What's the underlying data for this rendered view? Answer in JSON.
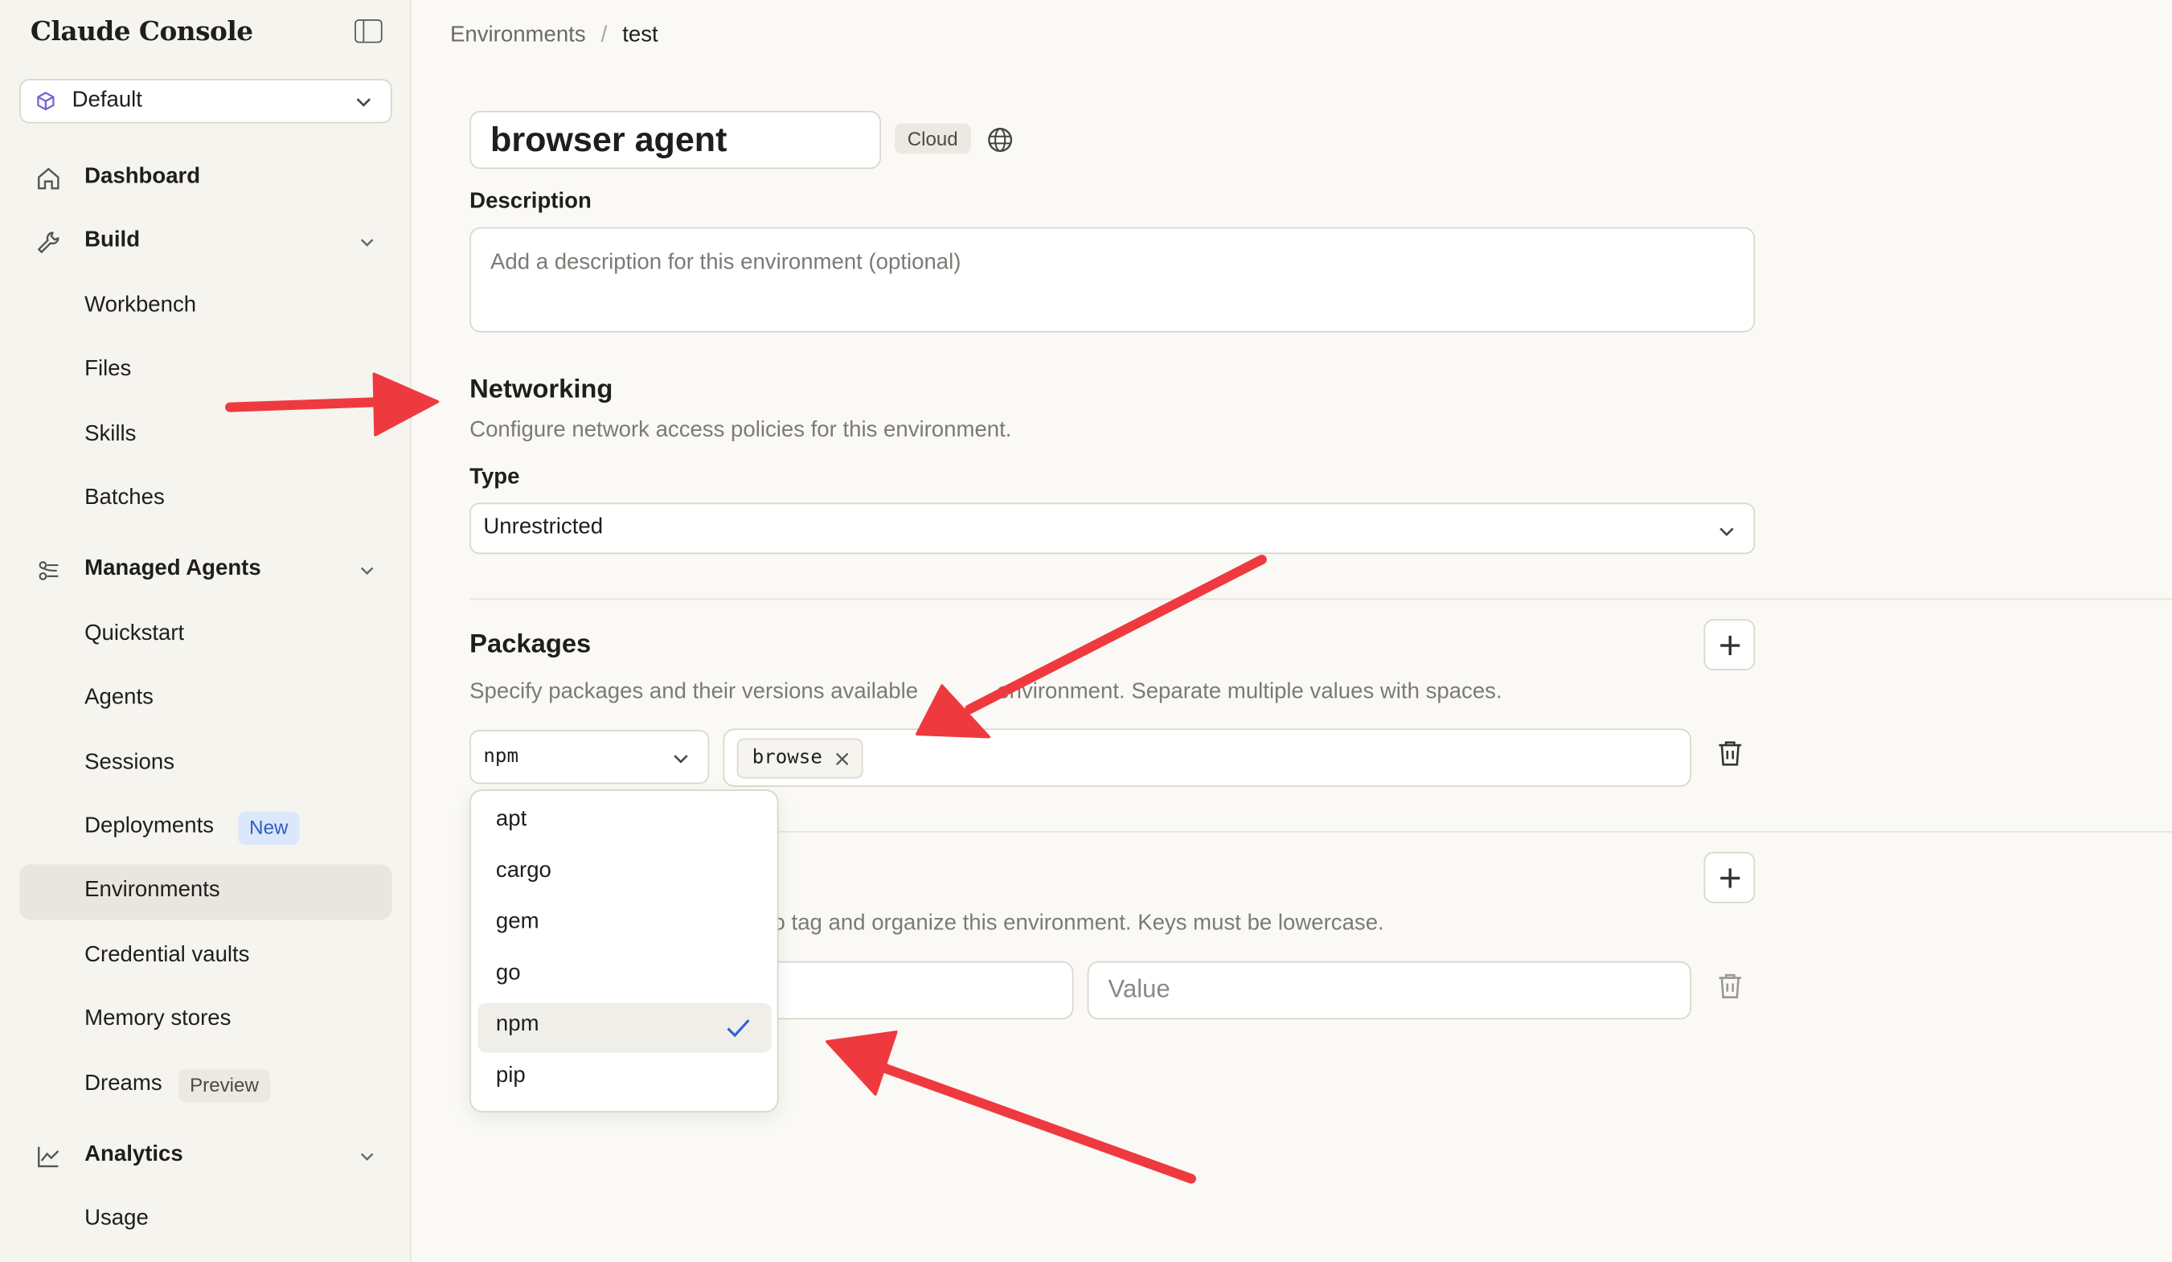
{
  "sidebar": {
    "brand": "Claude Console",
    "workspace": "Default",
    "dashboard": "Dashboard",
    "build": {
      "label": "Build",
      "items": [
        "Workbench",
        "Files",
        "Skills",
        "Batches"
      ]
    },
    "managed_agents": {
      "label": "Managed Agents",
      "items": [
        {
          "label": "Quickstart"
        },
        {
          "label": "Agents"
        },
        {
          "label": "Sessions"
        },
        {
          "label": "Deployments",
          "badge": "New"
        },
        {
          "label": "Environments",
          "active": true
        },
        {
          "label": "Credential vaults"
        },
        {
          "label": "Memory stores"
        },
        {
          "label": "Dreams",
          "badge": "Preview"
        }
      ]
    },
    "analytics": {
      "label": "Analytics",
      "items": [
        "Usage"
      ]
    }
  },
  "breadcrumb": {
    "parent": "Environments",
    "separator": "/",
    "current": "test"
  },
  "environment": {
    "name": "browser agent",
    "hosting_badge": "Cloud",
    "description_label": "Description",
    "description_placeholder": "Add a description for this environment (optional)"
  },
  "networking": {
    "title": "Networking",
    "subtitle": "Configure network access policies for this environment.",
    "type_label": "Type",
    "type_value": "Unrestricted"
  },
  "packages": {
    "title": "Packages",
    "subtitle_before": "Specify packages and their versions available",
    "subtitle_after": "environment. Separate multiple values with spaces.",
    "manager_value": "npm",
    "chips": [
      "browse"
    ]
  },
  "metadata": {
    "subtitle_visible": "o tag and organize this environment. Keys must be lowercase.",
    "value_placeholder": "Value"
  },
  "package_manager_dropdown": {
    "options": [
      "apt",
      "cargo",
      "gem",
      "go",
      "npm",
      "pip"
    ],
    "selected": "npm"
  },
  "colors": {
    "annotation_arrow": "#ee3a3f",
    "new_badge": "#2e5fbf",
    "background": "#faf9f5"
  }
}
